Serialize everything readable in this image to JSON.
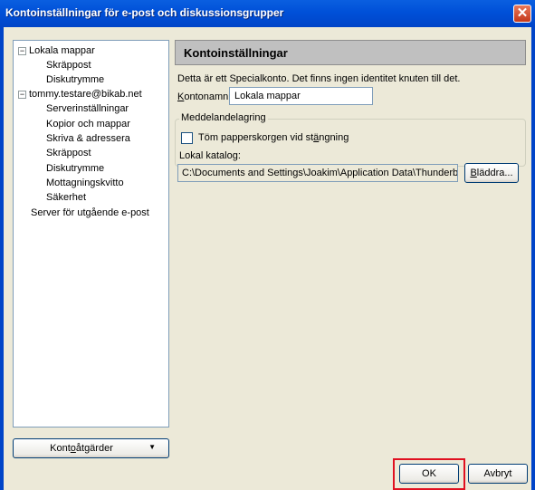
{
  "window": {
    "title": "Kontoinställningar för e-post och diskussionsgrupper",
    "close_glyph": "✕"
  },
  "tree": {
    "items": [
      {
        "label": "Lokala mappar",
        "level": 0,
        "toggle": "−"
      },
      {
        "label": "Skräppost",
        "level": 1
      },
      {
        "label": "Diskutrymme",
        "level": 1
      },
      {
        "label": "tommy.testare@bikab.net",
        "level": 0,
        "toggle": "−"
      },
      {
        "label": "Serverinställningar",
        "level": 1
      },
      {
        "label": "Kopior och mappar",
        "level": 1
      },
      {
        "label": "Skriva & adressera",
        "level": 1
      },
      {
        "label": "Skräppost",
        "level": 1
      },
      {
        "label": "Diskutrymme",
        "level": 1
      },
      {
        "label": "Mottagningskvitto",
        "level": 1
      },
      {
        "label": "Säkerhet",
        "level": 1
      },
      {
        "label": "Server för utgående e-post",
        "level": 0
      }
    ]
  },
  "account_actions": {
    "label_pre": "Kont",
    "label_u": "o",
    "label_post": "åtgärder",
    "arrow": "▼"
  },
  "panel": {
    "header": "Kontoinställningar",
    "description": "Detta är ett Specialkonto. Det finns ingen identitet knuten till det.",
    "account_name": {
      "label_u": "K",
      "label_rest": "ontonamn:",
      "value": "Lokala mappar"
    },
    "storage": {
      "legend": "Meddelandelagring",
      "empty_trash": {
        "pre": "Töm papperskorgen vid st",
        "u": "ä",
        "post": "ngning",
        "checked": false
      },
      "local_dir_label": "Lokal katalog:",
      "local_dir_value": "C:\\Documents and Settings\\Joakim\\Application Data\\Thunderbird\\Profiles",
      "browse": {
        "u": "B",
        "rest": "läddra..."
      }
    }
  },
  "buttons": {
    "ok": "OK",
    "cancel": "Avbryt"
  }
}
